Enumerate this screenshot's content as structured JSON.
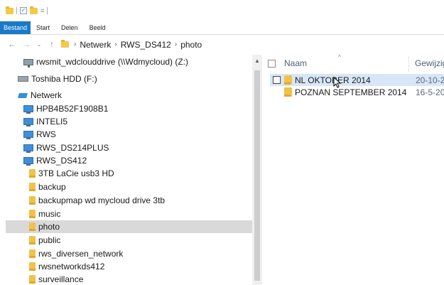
{
  "qat": {
    "undo_label": "="
  },
  "ribbon": {
    "tabs": [
      "Bestand",
      "Start",
      "Delen",
      "Beeld"
    ]
  },
  "address": {
    "crumbs": [
      "Netwerk",
      "RWS_DS412",
      "photo"
    ]
  },
  "nav": {
    "items": [
      {
        "label": "rwsmit_wdclouddrive (\\\\Wdmycloud) (Z:)",
        "icon": "network-drive-icon"
      },
      {
        "label": "Toshiba HDD (F:)",
        "icon": "drive-icon"
      },
      {
        "label": "Netwerk",
        "icon": "network-icon"
      },
      {
        "label": "HPB4B52F1908B1",
        "icon": "computer-icon"
      },
      {
        "label": "INTELI5",
        "icon": "computer-icon"
      },
      {
        "label": "RWS",
        "icon": "computer-icon"
      },
      {
        "label": "RWS_DS214PLUS",
        "icon": "computer-icon"
      },
      {
        "label": "RWS_DS412",
        "icon": "computer-icon"
      },
      {
        "label": "3TB LaCie usb3 HD",
        "icon": "folder-icon"
      },
      {
        "label": "backup",
        "icon": "folder-icon"
      },
      {
        "label": "backupmap wd mycloud drive 3tb",
        "icon": "folder-icon"
      },
      {
        "label": "music",
        "icon": "folder-icon"
      },
      {
        "label": "photo",
        "icon": "folder-icon",
        "selected": true
      },
      {
        "label": "public",
        "icon": "folder-icon"
      },
      {
        "label": "rws_diversen_network",
        "icon": "folder-icon"
      },
      {
        "label": "rwsnetworkds412",
        "icon": "folder-icon"
      },
      {
        "label": "surveillance",
        "icon": "folder-icon"
      }
    ]
  },
  "content": {
    "columns": {
      "name": "Naam",
      "date": "Gewijzig"
    },
    "rows": [
      {
        "name": "NL OKTOBER 2014",
        "date": "20-10-2"
      },
      {
        "name": "POZNAN SEPTEMBER 2014",
        "date": "16-5-20"
      }
    ]
  },
  "colors": {
    "accent": "#1979ca",
    "hover": "#d7e7f8",
    "selected": "#d9d9d9"
  }
}
